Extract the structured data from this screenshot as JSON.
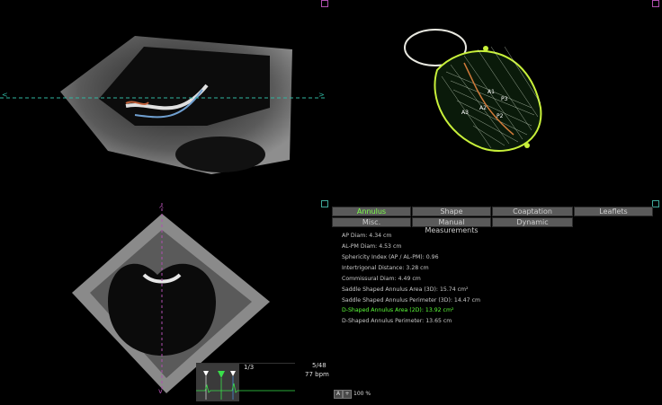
{
  "tabs": [
    {
      "label": "Annulus",
      "active": true
    },
    {
      "label": "Shape",
      "active": false
    },
    {
      "label": "Coaptation",
      "active": false
    },
    {
      "label": "Leaflets",
      "active": false
    },
    {
      "label": "Misc.",
      "active": false
    },
    {
      "label": "Manual Measurements",
      "active": false
    },
    {
      "label": "Dynamic",
      "active": false
    }
  ],
  "measurements": [
    {
      "text": "AP Diam: 4.34 cm",
      "highlight": false
    },
    {
      "text": "AL-PM Diam: 4.53 cm",
      "highlight": false
    },
    {
      "text": "Sphericity Index (AP / AL-PM): 0.96",
      "highlight": false
    },
    {
      "text": "Intertrigonal Distance: 3.28 cm",
      "highlight": false
    },
    {
      "text": "Commissural Diam: 4.49 cm",
      "highlight": false
    },
    {
      "text": "Saddle Shaped Annulus Area (3D): 15.74 cm²",
      "highlight": false
    },
    {
      "text": "Saddle Shaped Annulus Perimeter (3D): 14.47 cm",
      "highlight": false
    },
    {
      "text": "D-Shaped Annulus Area (2D): 13.92 cm²",
      "highlight": true
    },
    {
      "text": "D-Shaped Annulus Perimeter: 13.65 cm",
      "highlight": false
    }
  ],
  "model_labels": {
    "a1": "A1",
    "a2": "A2",
    "a3": "A3",
    "p2": "P2",
    "p3": "P3"
  },
  "cine": {
    "loop_index": "1/3",
    "frame": "5/48",
    "heart_rate": "77 bpm"
  },
  "zoom": {
    "minus": "A",
    "plus": "+",
    "level": "100 %"
  },
  "colors": {
    "accent_green": "#5dff3a",
    "tab_bg": "#5a5a5a",
    "corner_magenta": "#b04fb0",
    "corner_teal": "#3fa89a"
  }
}
